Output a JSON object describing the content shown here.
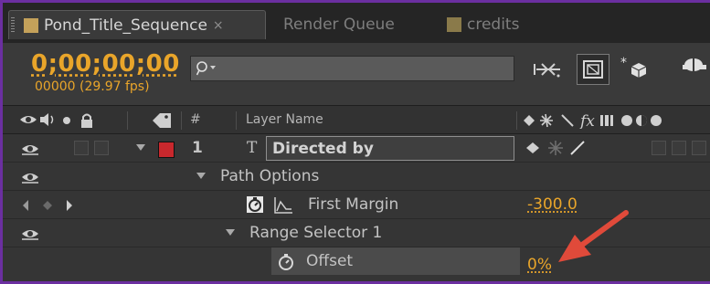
{
  "tabs": [
    {
      "label": "Pond_Title_Sequence",
      "swatch": "#c4a15a",
      "active": true,
      "close": "×"
    },
    {
      "label": "Render Queue",
      "active": false
    },
    {
      "label": "credits",
      "swatch": "#8a7a4a",
      "active": false
    }
  ],
  "header": {
    "timecode": "0;00;00;00",
    "frames": "00000 (29.97 fps)",
    "search": {
      "value": "",
      "placeholder": ""
    }
  },
  "columns": {
    "hash": "#",
    "layer_name": "Layer Name",
    "fx": "fx"
  },
  "layers": [
    {
      "number": "1",
      "type_icon": "T",
      "name": "Directed by",
      "label_color": "#c8282d"
    }
  ],
  "properties": {
    "path_options": "Path Options",
    "first_margin": {
      "label": "First Margin",
      "value": "-300.0"
    },
    "range_selector": "Range Selector 1",
    "offset": {
      "label": "Offset",
      "value": "0%"
    }
  },
  "colors": {
    "accent": "#e9a52a",
    "arrow": "#e04a3a",
    "frame": "#6b2fa0"
  }
}
